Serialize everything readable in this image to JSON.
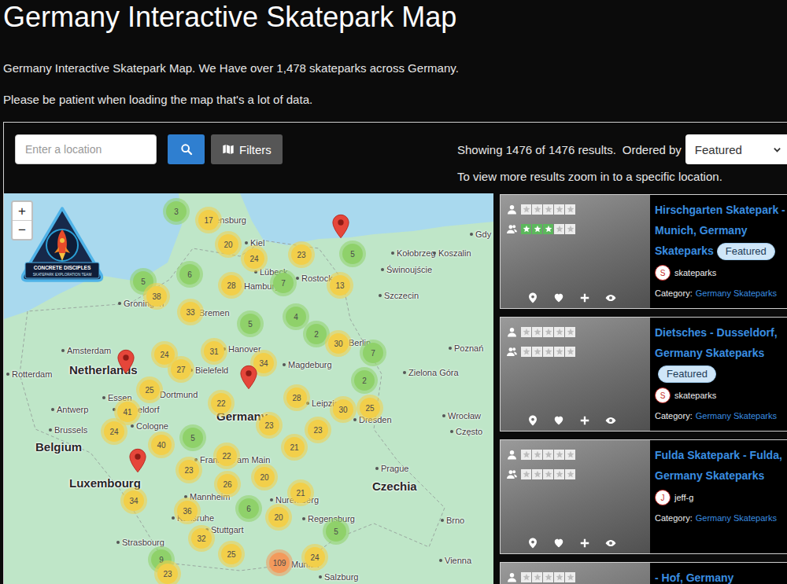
{
  "page": {
    "title": "Germany Interactive Skatepark Map",
    "intro": "Germany Interactive Skatepark Map. We Have over 1,478 skateparks across Germany.",
    "note": "Please be patient when loading the map that's a lot of data."
  },
  "search": {
    "placeholder": "Enter a location",
    "filters_label": "Filters"
  },
  "results": {
    "summary": "Showing 1476 of 1476 results.",
    "order_label": "Ordered by",
    "order_value": "Featured",
    "hint": "To view more results zoom in to a specific location."
  },
  "map": {
    "zoom_in": "+",
    "zoom_out": "−",
    "logo": {
      "title": "CONCRETE DISCIPLES",
      "subtitle": "SKATEPARK EXPLORATION TEAM"
    },
    "labels": [
      {
        "text": "Flensburg",
        "kind": "city"
      },
      {
        "text": "Kiel",
        "kind": "city"
      },
      {
        "text": "Lübeck",
        "kind": "city"
      },
      {
        "text": "Rostock",
        "kind": "city"
      },
      {
        "text": "Gdy",
        "kind": "city"
      },
      {
        "text": "Kołobrzeg",
        "kind": "city"
      },
      {
        "text": "Koszalin",
        "kind": "city"
      },
      {
        "text": "Świnoujście",
        "kind": "city"
      },
      {
        "text": "Szczecin",
        "kind": "city"
      },
      {
        "text": "Hamburg",
        "kind": "city"
      },
      {
        "text": "Groningen",
        "kind": "city"
      },
      {
        "text": "Bremen",
        "kind": "city"
      },
      {
        "text": "Amsterdam",
        "kind": "city"
      },
      {
        "text": "Netherlands",
        "kind": "country"
      },
      {
        "text": "Berlin",
        "kind": "city"
      },
      {
        "text": "Poznań",
        "kind": "city"
      },
      {
        "text": "Rotterdam",
        "kind": "city"
      },
      {
        "text": "Hanover",
        "kind": "city"
      },
      {
        "text": "Bielefeld",
        "kind": "city"
      },
      {
        "text": "Magdeburg",
        "kind": "city"
      },
      {
        "text": "Zielona Góra",
        "kind": "city"
      },
      {
        "text": "Essen",
        "kind": "city"
      },
      {
        "text": "Dortmund",
        "kind": "city"
      },
      {
        "text": "Antwerp",
        "kind": "city"
      },
      {
        "text": "Düsseldorf",
        "kind": "city"
      },
      {
        "text": "Leipzig",
        "kind": "city"
      },
      {
        "text": "Wrocław",
        "kind": "city"
      },
      {
        "text": "Brussels",
        "kind": "city"
      },
      {
        "text": "Cologne",
        "kind": "city"
      },
      {
        "text": "Germany",
        "kind": "country"
      },
      {
        "text": "Dresden",
        "kind": "city"
      },
      {
        "text": "Belgium",
        "kind": "country"
      },
      {
        "text": "Często",
        "kind": "city"
      },
      {
        "text": "Frankfurt am Main",
        "kind": "city"
      },
      {
        "text": "Prague",
        "kind": "city"
      },
      {
        "text": "Luxembourg",
        "kind": "country"
      },
      {
        "text": "Czechia",
        "kind": "country"
      },
      {
        "text": "Mannheim",
        "kind": "city"
      },
      {
        "text": "Nuremberg",
        "kind": "city"
      },
      {
        "text": "Karlsruhe",
        "kind": "city"
      },
      {
        "text": "Regensburg",
        "kind": "city"
      },
      {
        "text": "Strasbourg",
        "kind": "city"
      },
      {
        "text": "Stuttgart",
        "kind": "city"
      },
      {
        "text": "Brno",
        "kind": "city"
      },
      {
        "text": "Vienna",
        "kind": "city"
      },
      {
        "text": "Munich",
        "kind": "city"
      },
      {
        "text": "Salzburg",
        "kind": "city"
      }
    ],
    "markers": [
      {
        "kind": "cluster",
        "count": "3",
        "color": "#8fd16a"
      },
      {
        "kind": "cluster",
        "count": "17",
        "color": "#f2cf4a"
      },
      {
        "kind": "pin"
      },
      {
        "kind": "cluster",
        "count": "20",
        "color": "#f2cf4a"
      },
      {
        "kind": "cluster",
        "count": "24",
        "color": "#f2cf4a"
      },
      {
        "kind": "cluster",
        "count": "23",
        "color": "#f2cf4a"
      },
      {
        "kind": "cluster",
        "count": "5",
        "color": "#8fd16a"
      },
      {
        "kind": "cluster",
        "count": "5",
        "color": "#8fd16a"
      },
      {
        "kind": "cluster",
        "count": "6",
        "color": "#8fd16a"
      },
      {
        "kind": "cluster",
        "count": "38",
        "color": "#f2cf4a"
      },
      {
        "kind": "cluster",
        "count": "28",
        "color": "#f2cf4a"
      },
      {
        "kind": "cluster",
        "count": "7",
        "color": "#8fd16a"
      },
      {
        "kind": "cluster",
        "count": "13",
        "color": "#f2cf4a"
      },
      {
        "kind": "cluster",
        "count": "33",
        "color": "#f2cf4a"
      },
      {
        "kind": "cluster",
        "count": "5",
        "color": "#8fd16a"
      },
      {
        "kind": "cluster",
        "count": "4",
        "color": "#8fd16a"
      },
      {
        "kind": "cluster",
        "count": "2",
        "color": "#8fd16a"
      },
      {
        "kind": "cluster",
        "count": "30",
        "color": "#f2cf4a"
      },
      {
        "kind": "cluster",
        "count": "7",
        "color": "#8fd16a"
      },
      {
        "kind": "pin"
      },
      {
        "kind": "cluster",
        "count": "24",
        "color": "#f2cf4a"
      },
      {
        "kind": "cluster",
        "count": "31",
        "color": "#f2cf4a"
      },
      {
        "kind": "cluster",
        "count": "27",
        "color": "#f2cf4a"
      },
      {
        "kind": "cluster",
        "count": "34",
        "color": "#f2cf4a"
      },
      {
        "kind": "pin"
      },
      {
        "kind": "cluster",
        "count": "2",
        "color": "#8fd16a"
      },
      {
        "kind": "cluster",
        "count": "25",
        "color": "#f2cf4a"
      },
      {
        "kind": "cluster",
        "count": "28",
        "color": "#f2cf4a"
      },
      {
        "kind": "cluster",
        "count": "41",
        "color": "#f2cf4a"
      },
      {
        "kind": "cluster",
        "count": "22",
        "color": "#f2cf4a"
      },
      {
        "kind": "cluster",
        "count": "30",
        "color": "#f2cf4a"
      },
      {
        "kind": "cluster",
        "count": "25",
        "color": "#f2cf4a"
      },
      {
        "kind": "cluster",
        "count": "24",
        "color": "#f2cf4a"
      },
      {
        "kind": "cluster",
        "count": "5",
        "color": "#8fd16a"
      },
      {
        "kind": "cluster",
        "count": "23",
        "color": "#f2cf4a"
      },
      {
        "kind": "cluster",
        "count": "23",
        "color": "#f2cf4a"
      },
      {
        "kind": "cluster",
        "count": "40",
        "color": "#f2cf4a"
      },
      {
        "kind": "cluster",
        "count": "21",
        "color": "#f2cf4a"
      },
      {
        "kind": "pin"
      },
      {
        "kind": "cluster",
        "count": "22",
        "color": "#f2cf4a"
      },
      {
        "kind": "cluster",
        "count": "23",
        "color": "#f2cf4a"
      },
      {
        "kind": "cluster",
        "count": "26",
        "color": "#f2cf4a"
      },
      {
        "kind": "cluster",
        "count": "20",
        "color": "#f2cf4a"
      },
      {
        "kind": "cluster",
        "count": "21",
        "color": "#f2cf4a"
      },
      {
        "kind": "cluster",
        "count": "34",
        "color": "#f2cf4a"
      },
      {
        "kind": "cluster",
        "count": "6",
        "color": "#8fd16a"
      },
      {
        "kind": "cluster",
        "count": "36",
        "color": "#f2cf4a"
      },
      {
        "kind": "cluster",
        "count": "20",
        "color": "#f2cf4a"
      },
      {
        "kind": "cluster",
        "count": "5",
        "color": "#8fd16a"
      },
      {
        "kind": "cluster",
        "count": "32",
        "color": "#f2cf4a"
      },
      {
        "kind": "cluster",
        "count": "25",
        "color": "#f2cf4a"
      },
      {
        "kind": "cluster",
        "count": "109",
        "color": "#f39a5c"
      },
      {
        "kind": "cluster",
        "count": "24",
        "color": "#f2cf4a"
      },
      {
        "kind": "cluster",
        "count": "9",
        "color": "#8fd16a"
      },
      {
        "kind": "cluster",
        "count": "23",
        "color": "#f2cf4a"
      }
    ]
  },
  "listings": [
    {
      "title": "Hirschgarten Skatepark - Munich, Germany Skateparks",
      "featured": true,
      "badge": "Featured",
      "avatar": "S",
      "author": "skateparks",
      "category_label": "Category:",
      "category": "Germany Skateparks",
      "ratings": [
        {
          "stars": 0
        },
        {
          "stars": 3
        }
      ]
    },
    {
      "title": "Dietsches - Dusseldorf, Germany Skateparks",
      "featured": true,
      "badge": "Featured",
      "avatar": "S",
      "author": "skateparks",
      "category_label": "Category:",
      "category": "Germany Skateparks",
      "ratings": [
        {
          "stars": 0
        },
        {
          "stars": 0
        }
      ]
    },
    {
      "title": "Fulda Skatepark - Fulda, Germany Skateparks",
      "featured": false,
      "avatar": "J",
      "author": "jeff-g",
      "category_label": "Category:",
      "category": "Germany Skateparks",
      "ratings": [
        {
          "stars": 0
        },
        {
          "stars": 0
        }
      ]
    },
    {
      "title": "- Hof, Germany",
      "featured": false,
      "ratings": [
        {
          "stars": 0
        }
      ]
    }
  ]
}
